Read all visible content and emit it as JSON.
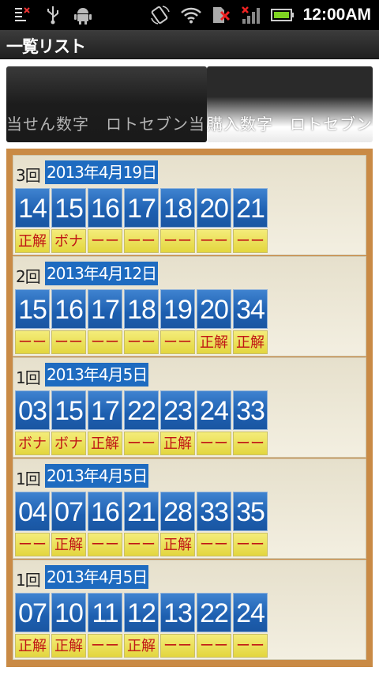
{
  "status_bar": {
    "time": "12:00AM",
    "icons": [
      "notification-icon",
      "usb-icon",
      "android-debug-icon",
      "rotation-icon",
      "wifi-icon",
      "no-sim-icon",
      "no-signal-icon",
      "battery-icon"
    ]
  },
  "title": "一覧リスト",
  "tabs": [
    {
      "label": "当せん数字　ロトセブン当"
    },
    {
      "label": "購入数字　ロトセブン"
    }
  ],
  "results": [
    {
      "round": "3回",
      "date": "2013年4月19日",
      "numbers": [
        "14",
        "15",
        "16",
        "17",
        "18",
        "20",
        "21"
      ],
      "marks": [
        "正解",
        "ボナ",
        "ーー",
        "ーー",
        "ーー",
        "ーー",
        "ーー"
      ]
    },
    {
      "round": "2回",
      "date": "2013年4月12日",
      "numbers": [
        "15",
        "16",
        "17",
        "18",
        "19",
        "20",
        "34"
      ],
      "marks": [
        "ーー",
        "ーー",
        "ーー",
        "ーー",
        "ーー",
        "正解",
        "正解"
      ]
    },
    {
      "round": "1回",
      "date": "2013年4月5日",
      "numbers": [
        "03",
        "15",
        "17",
        "22",
        "23",
        "24",
        "33"
      ],
      "marks": [
        "ボナ",
        "ボナ",
        "正解",
        "ーー",
        "正解",
        "ーー",
        "ーー"
      ]
    },
    {
      "round": "1回",
      "date": "2013年4月5日",
      "numbers": [
        "04",
        "07",
        "16",
        "21",
        "28",
        "33",
        "35"
      ],
      "marks": [
        "ーー",
        "正解",
        "ーー",
        "ーー",
        "正解",
        "ーー",
        "ーー"
      ]
    },
    {
      "round": "1回",
      "date": "2013年4月5日",
      "numbers": [
        "07",
        "10",
        "11",
        "12",
        "13",
        "22",
        "24"
      ],
      "marks": [
        "正解",
        "正解",
        "ーー",
        "正解",
        "ーー",
        "ーー",
        "ーー"
      ]
    }
  ]
}
